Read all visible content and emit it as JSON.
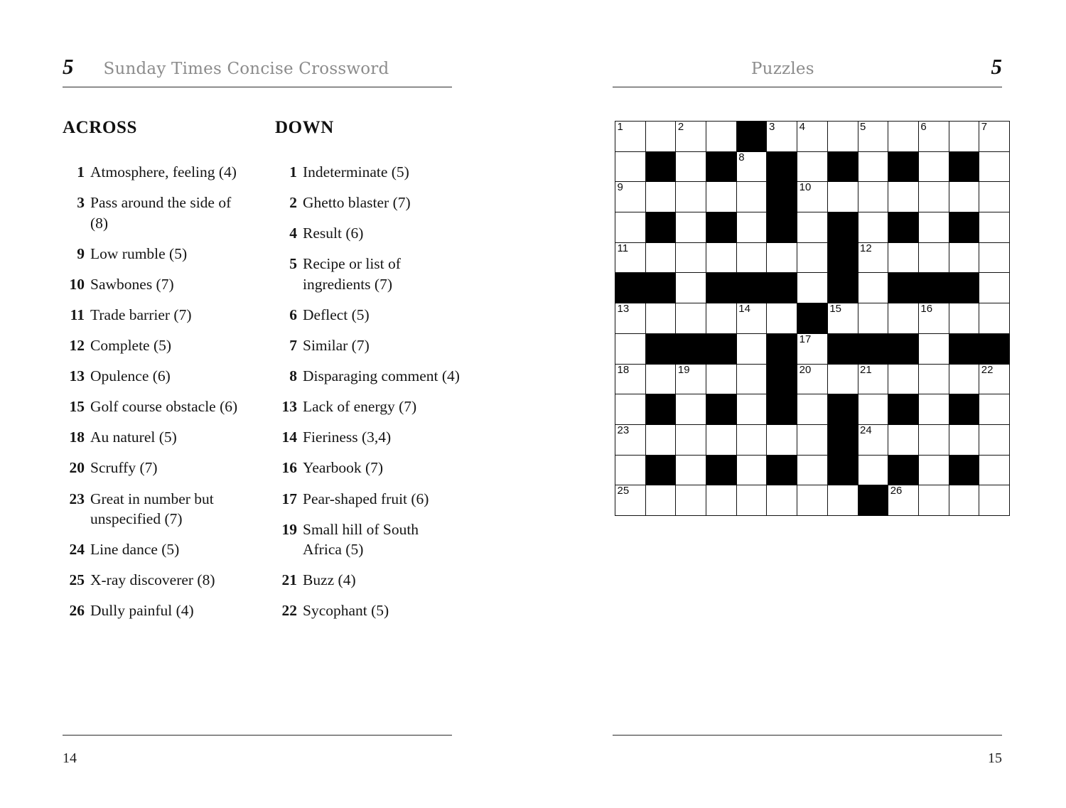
{
  "left_page": {
    "chapter_number": "5",
    "running_title": "Sunday Times Concise Crossword",
    "folio": "14",
    "across": {
      "heading": "ACROSS",
      "clues": [
        {
          "num": "1",
          "text": "Atmosphere, feeling (4)"
        },
        {
          "num": "3",
          "text": "Pass around the side of (8)"
        },
        {
          "num": "9",
          "text": "Low rumble (5)"
        },
        {
          "num": "10",
          "text": "Sawbones (7)"
        },
        {
          "num": "11",
          "text": "Trade barrier (7)"
        },
        {
          "num": "12",
          "text": "Complete (5)"
        },
        {
          "num": "13",
          "text": "Opulence (6)"
        },
        {
          "num": "15",
          "text": "Golf course obstacle (6)"
        },
        {
          "num": "18",
          "text": "Au naturel (5)"
        },
        {
          "num": "20",
          "text": "Scruffy (7)"
        },
        {
          "num": "23",
          "text": "Great in number but unspecified (7)"
        },
        {
          "num": "24",
          "text": "Line dance (5)"
        },
        {
          "num": "25",
          "text": "X-ray discoverer (8)"
        },
        {
          "num": "26",
          "text": "Dully painful (4)"
        }
      ]
    },
    "down": {
      "heading": "DOWN",
      "clues": [
        {
          "num": "1",
          "text": "Indeterminate (5)"
        },
        {
          "num": "2",
          "text": "Ghetto blaster (7)"
        },
        {
          "num": "4",
          "text": "Result (6)"
        },
        {
          "num": "5",
          "text": "Recipe or list of ingredients (7)"
        },
        {
          "num": "6",
          "text": "Deflect (5)"
        },
        {
          "num": "7",
          "text": "Similar (7)"
        },
        {
          "num": "8",
          "text": "Disparaging comment (4)"
        },
        {
          "num": "13",
          "text": "Lack of energy (7)"
        },
        {
          "num": "14",
          "text": "Fieriness (3,4)"
        },
        {
          "num": "16",
          "text": "Yearbook (7)"
        },
        {
          "num": "17",
          "text": "Pear-shaped fruit (6)"
        },
        {
          "num": "19",
          "text": "Small hill of South Africa (5)"
        },
        {
          "num": "21",
          "text": "Buzz (4)"
        },
        {
          "num": "22",
          "text": "Sycophant (5)"
        }
      ]
    }
  },
  "right_page": {
    "chapter_number": "5",
    "running_title": "Puzzles",
    "folio": "15"
  },
  "grid": {
    "rows": 13,
    "cols": 13,
    "colors": {
      "block": "#000000",
      "cell": "#ffffff",
      "border": "#131313"
    },
    "cells": [
      [
        {
          "b": false,
          "n": "1"
        },
        {
          "b": false,
          "n": ""
        },
        {
          "b": false,
          "n": "2"
        },
        {
          "b": false,
          "n": ""
        },
        {
          "b": true,
          "n": ""
        },
        {
          "b": false,
          "n": "3"
        },
        {
          "b": false,
          "n": "4"
        },
        {
          "b": false,
          "n": ""
        },
        {
          "b": false,
          "n": "5"
        },
        {
          "b": false,
          "n": ""
        },
        {
          "b": false,
          "n": "6"
        },
        {
          "b": false,
          "n": ""
        },
        {
          "b": false,
          "n": "7"
        }
      ],
      [
        {
          "b": false,
          "n": ""
        },
        {
          "b": true,
          "n": ""
        },
        {
          "b": false,
          "n": ""
        },
        {
          "b": true,
          "n": ""
        },
        {
          "b": false,
          "n": "8"
        },
        {
          "b": true,
          "n": ""
        },
        {
          "b": false,
          "n": ""
        },
        {
          "b": true,
          "n": ""
        },
        {
          "b": false,
          "n": ""
        },
        {
          "b": true,
          "n": ""
        },
        {
          "b": false,
          "n": ""
        },
        {
          "b": true,
          "n": ""
        },
        {
          "b": false,
          "n": ""
        }
      ],
      [
        {
          "b": false,
          "n": "9"
        },
        {
          "b": false,
          "n": ""
        },
        {
          "b": false,
          "n": ""
        },
        {
          "b": false,
          "n": ""
        },
        {
          "b": false,
          "n": ""
        },
        {
          "b": true,
          "n": ""
        },
        {
          "b": false,
          "n": "10"
        },
        {
          "b": false,
          "n": ""
        },
        {
          "b": false,
          "n": ""
        },
        {
          "b": false,
          "n": ""
        },
        {
          "b": false,
          "n": ""
        },
        {
          "b": false,
          "n": ""
        },
        {
          "b": false,
          "n": ""
        }
      ],
      [
        {
          "b": false,
          "n": ""
        },
        {
          "b": true,
          "n": ""
        },
        {
          "b": false,
          "n": ""
        },
        {
          "b": true,
          "n": ""
        },
        {
          "b": false,
          "n": ""
        },
        {
          "b": true,
          "n": ""
        },
        {
          "b": false,
          "n": ""
        },
        {
          "b": true,
          "n": ""
        },
        {
          "b": false,
          "n": ""
        },
        {
          "b": true,
          "n": ""
        },
        {
          "b": false,
          "n": ""
        },
        {
          "b": true,
          "n": ""
        },
        {
          "b": false,
          "n": ""
        }
      ],
      [
        {
          "b": false,
          "n": "11"
        },
        {
          "b": false,
          "n": ""
        },
        {
          "b": false,
          "n": ""
        },
        {
          "b": false,
          "n": ""
        },
        {
          "b": false,
          "n": ""
        },
        {
          "b": false,
          "n": ""
        },
        {
          "b": false,
          "n": ""
        },
        {
          "b": true,
          "n": ""
        },
        {
          "b": false,
          "n": "12"
        },
        {
          "b": false,
          "n": ""
        },
        {
          "b": false,
          "n": ""
        },
        {
          "b": false,
          "n": ""
        },
        {
          "b": false,
          "n": ""
        }
      ],
      [
        {
          "b": true,
          "n": ""
        },
        {
          "b": true,
          "n": ""
        },
        {
          "b": false,
          "n": ""
        },
        {
          "b": true,
          "n": ""
        },
        {
          "b": true,
          "n": ""
        },
        {
          "b": true,
          "n": ""
        },
        {
          "b": false,
          "n": ""
        },
        {
          "b": true,
          "n": ""
        },
        {
          "b": false,
          "n": ""
        },
        {
          "b": true,
          "n": ""
        },
        {
          "b": true,
          "n": ""
        },
        {
          "b": true,
          "n": ""
        },
        {
          "b": false,
          "n": ""
        }
      ],
      [
        {
          "b": false,
          "n": "13"
        },
        {
          "b": false,
          "n": ""
        },
        {
          "b": false,
          "n": ""
        },
        {
          "b": false,
          "n": ""
        },
        {
          "b": false,
          "n": "14"
        },
        {
          "b": false,
          "n": ""
        },
        {
          "b": true,
          "n": ""
        },
        {
          "b": false,
          "n": "15"
        },
        {
          "b": false,
          "n": ""
        },
        {
          "b": false,
          "n": ""
        },
        {
          "b": false,
          "n": "16"
        },
        {
          "b": false,
          "n": ""
        },
        {
          "b": false,
          "n": ""
        }
      ],
      [
        {
          "b": false,
          "n": ""
        },
        {
          "b": true,
          "n": ""
        },
        {
          "b": true,
          "n": ""
        },
        {
          "b": true,
          "n": ""
        },
        {
          "b": false,
          "n": ""
        },
        {
          "b": true,
          "n": ""
        },
        {
          "b": false,
          "n": "17"
        },
        {
          "b": true,
          "n": ""
        },
        {
          "b": true,
          "n": ""
        },
        {
          "b": true,
          "n": ""
        },
        {
          "b": false,
          "n": ""
        },
        {
          "b": true,
          "n": ""
        },
        {
          "b": true,
          "n": ""
        }
      ],
      [
        {
          "b": false,
          "n": "18"
        },
        {
          "b": false,
          "n": ""
        },
        {
          "b": false,
          "n": "19"
        },
        {
          "b": false,
          "n": ""
        },
        {
          "b": false,
          "n": ""
        },
        {
          "b": true,
          "n": ""
        },
        {
          "b": false,
          "n": "20"
        },
        {
          "b": false,
          "n": ""
        },
        {
          "b": false,
          "n": "21"
        },
        {
          "b": false,
          "n": ""
        },
        {
          "b": false,
          "n": ""
        },
        {
          "b": false,
          "n": ""
        },
        {
          "b": false,
          "n": "22"
        }
      ],
      [
        {
          "b": false,
          "n": ""
        },
        {
          "b": true,
          "n": ""
        },
        {
          "b": false,
          "n": ""
        },
        {
          "b": true,
          "n": ""
        },
        {
          "b": false,
          "n": ""
        },
        {
          "b": true,
          "n": ""
        },
        {
          "b": false,
          "n": ""
        },
        {
          "b": true,
          "n": ""
        },
        {
          "b": false,
          "n": ""
        },
        {
          "b": true,
          "n": ""
        },
        {
          "b": false,
          "n": ""
        },
        {
          "b": true,
          "n": ""
        },
        {
          "b": false,
          "n": ""
        }
      ],
      [
        {
          "b": false,
          "n": "23"
        },
        {
          "b": false,
          "n": ""
        },
        {
          "b": false,
          "n": ""
        },
        {
          "b": false,
          "n": ""
        },
        {
          "b": false,
          "n": ""
        },
        {
          "b": false,
          "n": ""
        },
        {
          "b": false,
          "n": ""
        },
        {
          "b": true,
          "n": ""
        },
        {
          "b": false,
          "n": "24"
        },
        {
          "b": false,
          "n": ""
        },
        {
          "b": false,
          "n": ""
        },
        {
          "b": false,
          "n": ""
        },
        {
          "b": false,
          "n": ""
        }
      ],
      [
        {
          "b": false,
          "n": ""
        },
        {
          "b": true,
          "n": ""
        },
        {
          "b": false,
          "n": ""
        },
        {
          "b": true,
          "n": ""
        },
        {
          "b": false,
          "n": ""
        },
        {
          "b": true,
          "n": ""
        },
        {
          "b": false,
          "n": ""
        },
        {
          "b": true,
          "n": ""
        },
        {
          "b": false,
          "n": ""
        },
        {
          "b": true,
          "n": ""
        },
        {
          "b": false,
          "n": ""
        },
        {
          "b": true,
          "n": ""
        },
        {
          "b": false,
          "n": ""
        }
      ],
      [
        {
          "b": false,
          "n": "25"
        },
        {
          "b": false,
          "n": ""
        },
        {
          "b": false,
          "n": ""
        },
        {
          "b": false,
          "n": ""
        },
        {
          "b": false,
          "n": ""
        },
        {
          "b": false,
          "n": ""
        },
        {
          "b": false,
          "n": ""
        },
        {
          "b": false,
          "n": ""
        },
        {
          "b": true,
          "n": ""
        },
        {
          "b": false,
          "n": "26"
        },
        {
          "b": false,
          "n": ""
        },
        {
          "b": false,
          "n": ""
        },
        {
          "b": false,
          "n": ""
        }
      ]
    ]
  }
}
